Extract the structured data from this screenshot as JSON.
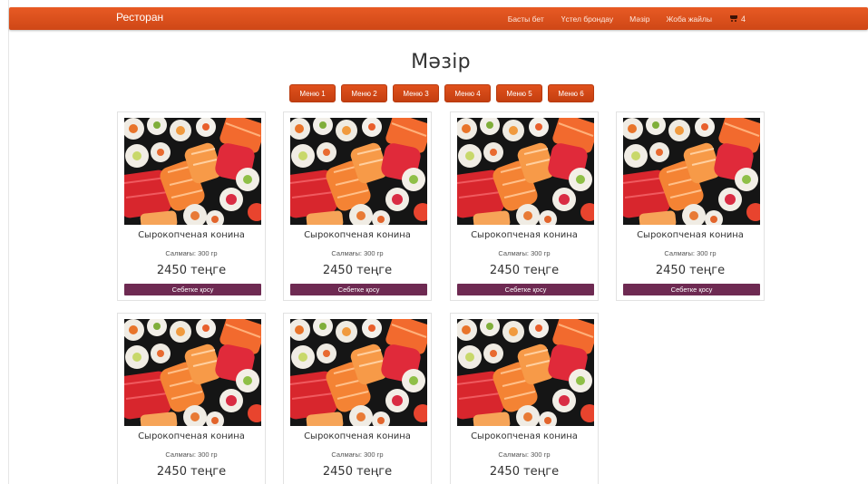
{
  "header": {
    "brand": "Ресторан",
    "nav": [
      "Басты бет",
      "Үстел брондау",
      "Мәзір",
      "Жоба жайлы"
    ],
    "cart_count": "4",
    "colors": {
      "navbar": "#d94f1c",
      "accent_button": "#6e2a52"
    }
  },
  "main": {
    "title": "Мәзір",
    "tabs": [
      "Меню 1",
      "Меню 2",
      "Меню 3",
      "Меню 4",
      "Меню 5",
      "Меню 6"
    ],
    "products": [
      {
        "name": "Сырокопченая конина",
        "weight": "Салмағы: 300 гр",
        "price": "2450 теңге",
        "button": "Себетке қосу",
        "image": "sushi-photo"
      },
      {
        "name": "Сырокопченая конина",
        "weight": "Салмағы: 300 гр",
        "price": "2450 теңге",
        "button": "Себетке қосу",
        "image": "sushi-photo"
      },
      {
        "name": "Сырокопченая конина",
        "weight": "Салмағы: 300 гр",
        "price": "2450 теңге",
        "button": "Себетке қосу",
        "image": "sushi-photo"
      },
      {
        "name": "Сырокопченая конина",
        "weight": "Салмағы: 300 гр",
        "price": "2450 теңге",
        "button": "Себетке қосу",
        "image": "sushi-photo"
      },
      {
        "name": "Сырокопченая конина",
        "weight": "Салмағы: 300 гр",
        "price": "2450 теңге",
        "image": "sushi-photo"
      },
      {
        "name": "Сырокопченая конина",
        "weight": "Салмағы: 300 гр",
        "price": "2450 теңге",
        "image": "sushi-photo"
      },
      {
        "name": "Сырокопченая конина",
        "weight": "Салмағы: 300 гр",
        "price": "2450 теңге",
        "image": "sushi-photo"
      }
    ]
  }
}
